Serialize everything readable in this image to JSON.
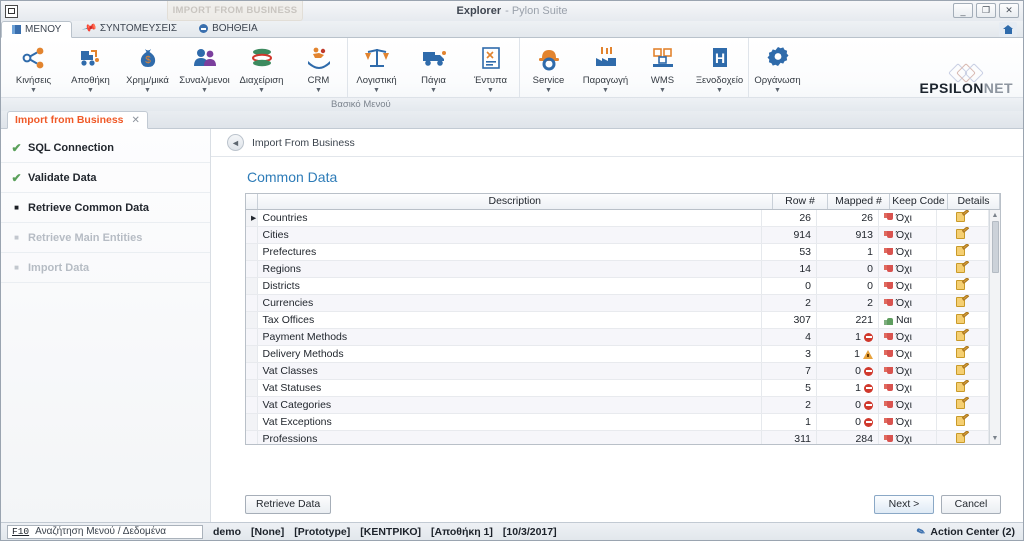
{
  "window": {
    "ghost_tab": "IMPORT FROM BUSINESS",
    "app_name": "Explorer",
    "app_suffix": "- Pylon Suite",
    "minimize": "_",
    "maximize": "❐",
    "close": "✕",
    "home_icon": "home-icon"
  },
  "menu_tabs": [
    {
      "label": "ΜΕΝΟΥ",
      "icon": "book-icon",
      "active": true
    },
    {
      "label": "ΣΥΝΤΟΜΕΥΣΕΙΣ",
      "icon": "pin-icon",
      "active": false
    },
    {
      "label": "ΒΟΗΘΕΙΑ",
      "icon": "help-icon",
      "active": false
    }
  ],
  "ribbon": {
    "footer_label": "Βασικό Μενού",
    "caret": "▼",
    "brand": {
      "bold": "EPSILON",
      "light": "NET"
    },
    "groups": [
      {
        "items": [
          {
            "label": "Κινήσεις",
            "icon": "share-nodes-icon"
          },
          {
            "label": "Αποθήκη",
            "icon": "warehouse-forklift-icon"
          },
          {
            "label": "Χρημ/μικά",
            "icon": "money-bag-icon"
          },
          {
            "label": "Συναλ/μενοι",
            "icon": "people-icon"
          },
          {
            "label": "Διαχείριση",
            "icon": "database-icon"
          },
          {
            "label": "CRM",
            "icon": "handshake-crm-icon"
          }
        ]
      },
      {
        "items": [
          {
            "label": "Λογιστική",
            "icon": "scales-icon"
          },
          {
            "label": "Πάγια",
            "icon": "truck-icon"
          },
          {
            "label": "Έντυπα",
            "icon": "form-document-icon"
          }
        ]
      },
      {
        "items": [
          {
            "label": "Service",
            "icon": "gear-helmet-icon"
          },
          {
            "label": "Παραγωγή",
            "icon": "factory-icon"
          },
          {
            "label": "WMS",
            "icon": "pallet-boxes-icon"
          },
          {
            "label": "Ξενοδοχείο",
            "icon": "hotel-icon"
          }
        ]
      },
      {
        "items": [
          {
            "label": "Οργάνωση",
            "icon": "gear-icon"
          }
        ]
      }
    ]
  },
  "doc_tab": {
    "label": "Import from Business",
    "close": "✕"
  },
  "steps": [
    {
      "label": "SQL Connection",
      "state": "done",
      "marker": "✔"
    },
    {
      "label": "Validate Data",
      "state": "done",
      "marker": "✔"
    },
    {
      "label": "Retrieve Common Data",
      "state": "current",
      "marker": "■"
    },
    {
      "label": "Retrieve Main Entities",
      "state": "disabled",
      "marker": "■"
    },
    {
      "label": "Import Data",
      "state": "disabled",
      "marker": "■"
    }
  ],
  "breadcrumb": {
    "back_icon": "◄",
    "title": "Import From Business"
  },
  "section_title": "Common Data",
  "grid": {
    "columns": [
      "",
      "Description",
      "Row #",
      "Mapped #",
      "Keep Code",
      "Details",
      ""
    ],
    "rows": [
      {
        "indicator": "▸",
        "description": "Countries",
        "row_count": "26",
        "mapped": "26",
        "map_icon": "",
        "keep_icon": "thumbs-down-icon",
        "keep": "Όχι",
        "details": "edit-pencil-icon"
      },
      {
        "indicator": "",
        "description": "Cities",
        "row_count": "914",
        "mapped": "913",
        "map_icon": "",
        "keep_icon": "thumbs-down-icon",
        "keep": "Όχι",
        "details": "edit-pencil-icon"
      },
      {
        "indicator": "",
        "description": "Prefectures",
        "row_count": "53",
        "mapped": "1",
        "map_icon": "",
        "keep_icon": "thumbs-down-icon",
        "keep": "Όχι",
        "details": "edit-pencil-icon"
      },
      {
        "indicator": "",
        "description": "Regions",
        "row_count": "14",
        "mapped": "0",
        "map_icon": "",
        "keep_icon": "thumbs-down-icon",
        "keep": "Όχι",
        "details": "edit-pencil-icon"
      },
      {
        "indicator": "",
        "description": "Districts",
        "row_count": "0",
        "mapped": "0",
        "map_icon": "",
        "keep_icon": "thumbs-down-icon",
        "keep": "Όχι",
        "details": "edit-pencil-icon"
      },
      {
        "indicator": "",
        "description": "Currencies",
        "row_count": "2",
        "mapped": "2",
        "map_icon": "",
        "keep_icon": "thumbs-down-icon",
        "keep": "Όχι",
        "details": "edit-pencil-icon"
      },
      {
        "indicator": "",
        "description": "Tax Offices",
        "row_count": "307",
        "mapped": "221",
        "map_icon": "",
        "keep_icon": "thumbs-up-icon",
        "keep": "Ναι",
        "details": "edit-pencil-icon"
      },
      {
        "indicator": "",
        "description": "Payment Methods",
        "row_count": "4",
        "mapped": "1",
        "map_icon": "stop-icon",
        "keep_icon": "thumbs-down-icon",
        "keep": "Όχι",
        "details": "edit-pencil-icon"
      },
      {
        "indicator": "",
        "description": "Delivery Methods",
        "row_count": "3",
        "mapped": "1",
        "map_icon": "warning-icon",
        "keep_icon": "thumbs-down-icon",
        "keep": "Όχι",
        "details": "edit-pencil-icon"
      },
      {
        "indicator": "",
        "description": "Vat Classes",
        "row_count": "7",
        "mapped": "0",
        "map_icon": "stop-icon",
        "keep_icon": "thumbs-down-icon",
        "keep": "Όχι",
        "details": "edit-pencil-icon"
      },
      {
        "indicator": "",
        "description": "Vat Statuses",
        "row_count": "5",
        "mapped": "1",
        "map_icon": "stop-icon",
        "keep_icon": "thumbs-down-icon",
        "keep": "Όχι",
        "details": "edit-pencil-icon"
      },
      {
        "indicator": "",
        "description": "Vat Categories",
        "row_count": "2",
        "mapped": "0",
        "map_icon": "stop-icon",
        "keep_icon": "thumbs-down-icon",
        "keep": "Όχι",
        "details": "edit-pencil-icon"
      },
      {
        "indicator": "",
        "description": "Vat Exceptions",
        "row_count": "1",
        "mapped": "0",
        "map_icon": "stop-icon",
        "keep_icon": "thumbs-down-icon",
        "keep": "Όχι",
        "details": "edit-pencil-icon"
      },
      {
        "indicator": "",
        "description": "Professions",
        "row_count": "311",
        "mapped": "284",
        "map_icon": "",
        "keep_icon": "thumbs-down-icon",
        "keep": "Όχι",
        "details": "edit-pencil-icon"
      }
    ],
    "scroll_up": "▲",
    "scroll_down": "▼"
  },
  "buttons": {
    "retrieve": "Retrieve Data",
    "next": "Next >",
    "cancel": "Cancel"
  },
  "statusbar": {
    "fkey": "F10",
    "search_label": "Αναζήτηση Μενού / Δεδομένα",
    "items": [
      "demo",
      "[None]",
      "[Prototype]",
      "[ΚΕΝΤΡΙΚΟ]",
      "[Αποθήκη 1]",
      "[10/3/2017]"
    ],
    "action_center": "Action Center (2)",
    "action_icon": "wand-icon"
  },
  "colors": {
    "accent_orange": "#f05a28",
    "section_blue": "#2e7cb8",
    "icon_blue": "#2f6bab",
    "icon_orange": "#e2842f"
  }
}
